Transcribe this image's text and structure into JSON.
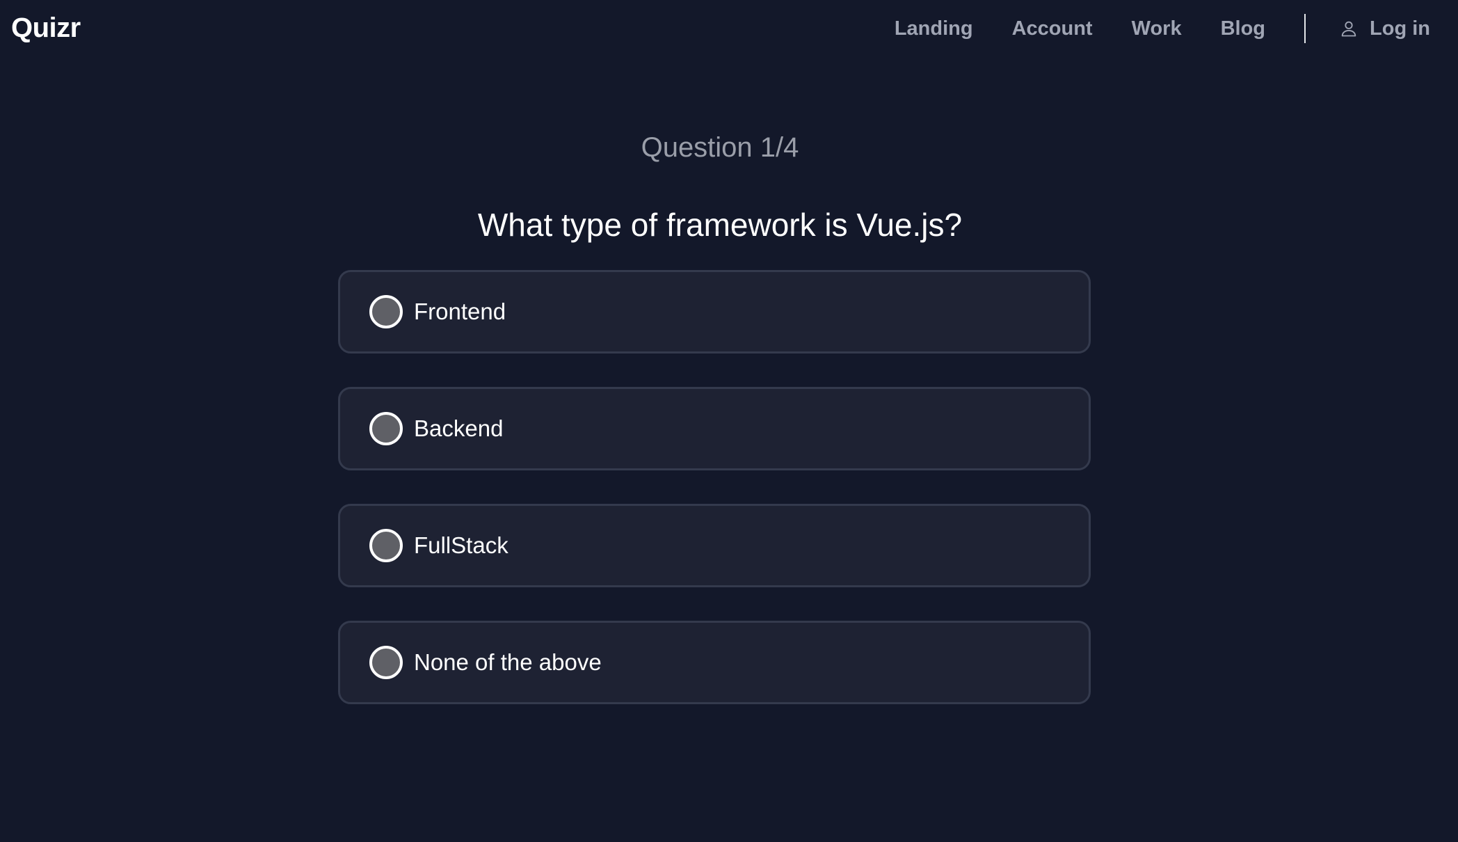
{
  "header": {
    "brand": "Quizr",
    "nav": [
      {
        "label": "Landing"
      },
      {
        "label": "Account"
      },
      {
        "label": "Work"
      },
      {
        "label": "Blog"
      }
    ],
    "login": {
      "label": "Log in",
      "icon": "user-icon"
    }
  },
  "quiz": {
    "counter": "Question 1/4",
    "question": "What type of framework is Vue.js?",
    "options": [
      {
        "label": "Frontend",
        "selected": false
      },
      {
        "label": "Backend",
        "selected": false
      },
      {
        "label": "FullStack",
        "selected": false
      },
      {
        "label": "None of the above",
        "selected": false
      }
    ]
  },
  "colors": {
    "background": "#13182a",
    "card": "#1e2233",
    "card_border": "#343a4d",
    "nav_text": "#a0a5b4",
    "muted_text": "#9a9ea9",
    "radio_fill": "#5f6066"
  }
}
